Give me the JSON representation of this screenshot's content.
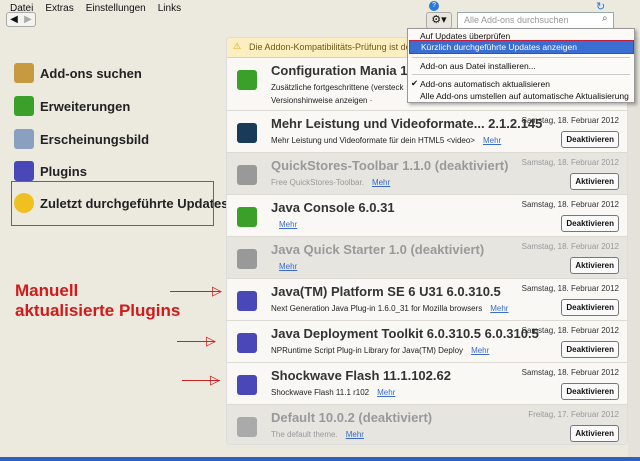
{
  "menubar": [
    "Datei",
    "Extras",
    "Einstellungen",
    "Links"
  ],
  "search": {
    "placeholder": "Alle Add-ons durchsuchen"
  },
  "sidebar": [
    {
      "label": "Add-ons suchen",
      "icon": "download-box-icon",
      "color": "#c89a40"
    },
    {
      "label": "Erweiterungen",
      "icon": "puzzle-icon",
      "color": "#3aa02a"
    },
    {
      "label": "Erscheinungsbild",
      "icon": "palette-icon",
      "color": "#8aa0c0"
    },
    {
      "label": "Plugins",
      "icon": "plugin-brick-icon",
      "color": "#4a48b8"
    },
    {
      "label": "Zuletzt durchgeführte Updates",
      "icon": "update-arrow-icon",
      "color": "#f0c020"
    }
  ],
  "warning": "Die Addon-Kompatibilitäts-Prüfung ist deaktiv",
  "menu": {
    "items": [
      "Auf Updates überprüfen",
      "Kürzlich durchgeführte Updates anzeigen",
      "Add-on aus Datei installieren...",
      "Add-ons automatisch aktualisieren",
      "Alle Add-ons umstellen auf automatische Aktualisierung"
    ],
    "checked": "Add-ons automatisch aktualisieren",
    "highlighted": "Kürzlich durchgeführte Updates anzeigen",
    "highlight_color": "#3a6ed0"
  },
  "annotation": {
    "line1": "Manuell",
    "line2": "aktualisierte Plugins",
    "color": "#d31a1a"
  },
  "rows": [
    {
      "name": "Configuration Mania  1.15",
      "desc": "Zusätzliche fortgeschrittene (versteck",
      "extra": "Versionshinweise anzeigen ·",
      "date": "",
      "button": "",
      "more": "",
      "disabled": false,
      "icon": "puzzle-icon",
      "color": "#3aa02a"
    },
    {
      "name": "Mehr Leistung und Videoformate...  2.1.2.145",
      "desc": "Mehr Leistung und Videoformate für dein HTML5 <video>",
      "more": "Mehr",
      "date": "Samstag, 18. Februar 2012",
      "button": "Deaktivieren",
      "disabled": false,
      "icon": "video-play-icon",
      "color": "#1a3a5a"
    },
    {
      "name": "QuickStores-Toolbar  1.1.0  (deaktiviert)",
      "desc": "Free QuickStores-Toolbar.",
      "more": "Mehr",
      "date": "Samstag, 18. Februar 2012",
      "button": "Aktivieren",
      "disabled": true,
      "icon": "puzzle-icon",
      "color": "#999999"
    },
    {
      "name": "Java Console  6.0.31",
      "desc": "",
      "more": "Mehr",
      "date": "Samstag, 18. Februar 2012",
      "button": "Deaktivieren",
      "disabled": false,
      "icon": "puzzle-icon",
      "color": "#3aa02a"
    },
    {
      "name": "Java Quick Starter  1.0  (deaktiviert)",
      "desc": "",
      "more": "Mehr",
      "date": "Samstag, 18. Februar 2012",
      "button": "Aktivieren",
      "disabled": true,
      "icon": "puzzle-icon",
      "color": "#999999"
    },
    {
      "name": "Java(TM) Platform SE 6 U31  6.0.310.5",
      "desc": "Next Generation Java Plug-in 1.6.0_31 for Mozilla browsers",
      "more": "Mehr",
      "date": "Samstag, 18. Februar 2012",
      "button": "Deaktivieren",
      "disabled": false,
      "icon": "plugin-brick-icon",
      "color": "#4a48b8"
    },
    {
      "name": "Java Deployment Toolkit 6.0.310.5  6.0.310.5",
      "desc": "NPRuntime Script Plug-in Library for Java(TM) Deploy",
      "more": "Mehr",
      "date": "Samstag, 18. Februar 2012",
      "button": "Deaktivieren",
      "disabled": false,
      "icon": "plugin-brick-icon",
      "color": "#4a48b8"
    },
    {
      "name": "Shockwave Flash  11.1.102.62",
      "desc": "Shockwave Flash 11.1 r102",
      "more": "Mehr",
      "date": "Samstag, 18. Februar 2012",
      "button": "Deaktivieren",
      "disabled": false,
      "icon": "plugin-brick-icon",
      "color": "#4a48b8"
    },
    {
      "name": "Default  10.0.2  (deaktiviert)",
      "desc": "The default theme.",
      "more": "Mehr",
      "date": "Freitag, 17. Februar 2012",
      "button": "Aktivieren",
      "disabled": true,
      "icon": "theme-palette-icon",
      "color": "#aaaaaa"
    }
  ]
}
